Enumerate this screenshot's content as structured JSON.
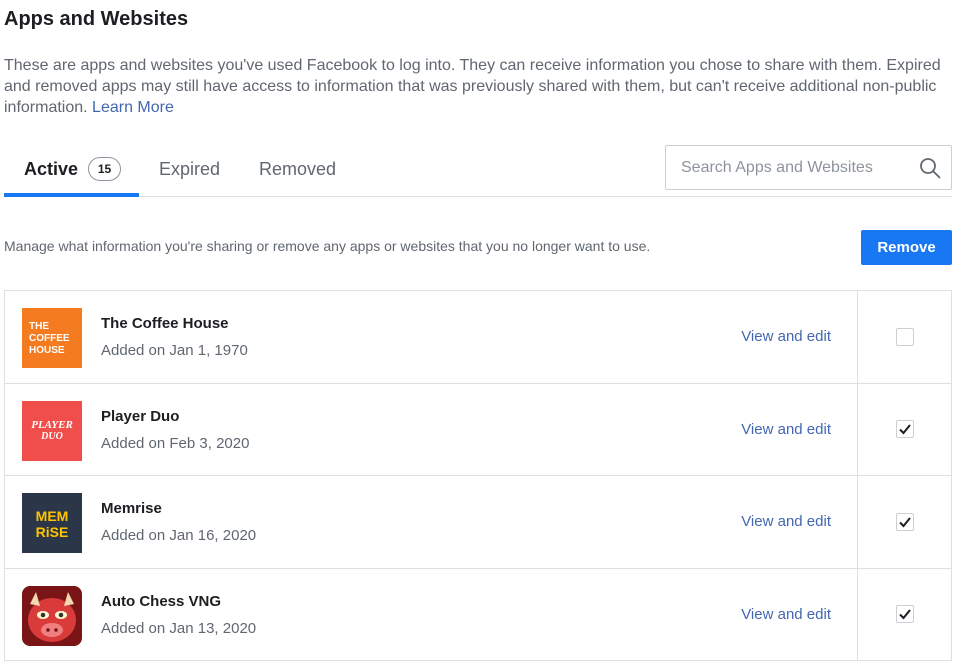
{
  "page_title": "Apps and Websites",
  "intro": {
    "text": "These are apps and websites you've used Facebook to log into. They can receive information you chose to share with them. Expired and removed apps may still have access to information that was previously shared with them, but can't receive additional non-public information.",
    "link": "Learn More"
  },
  "tabs": [
    {
      "label": "Active",
      "count": "15"
    },
    {
      "label": "Expired"
    },
    {
      "label": "Removed"
    }
  ],
  "search": {
    "placeholder": "Search Apps and Websites"
  },
  "manage_text": "Manage what information you're sharing or remove any apps or websites that you no longer want to use.",
  "remove_label": "Remove",
  "apps": [
    {
      "name": "The Coffee House",
      "date": "Added on Jan 1, 1970",
      "action": "View and edit",
      "checked": false,
      "icon": "coffee-house-logo",
      "icon_text": [
        "THE",
        "COFFEE",
        "HOUSE"
      ]
    },
    {
      "name": "Player Duo",
      "date": "Added on Feb 3, 2020",
      "action": "View and edit",
      "checked": true,
      "icon": "player-duo-logo",
      "icon_text": [
        "PLAYER",
        "DUO"
      ]
    },
    {
      "name": "Memrise",
      "date": "Added on Jan 16, 2020",
      "action": "View and edit",
      "checked": true,
      "icon": "memrise-logo",
      "icon_text": [
        "MEM",
        "RiSE"
      ]
    },
    {
      "name": "Auto Chess VNG",
      "date": "Added on Jan 13, 2020",
      "action": "View and edit",
      "checked": true,
      "icon": "auto-chess-logo"
    }
  ],
  "colors": {
    "accent": "#1877f2",
    "link": "#4267b2"
  }
}
